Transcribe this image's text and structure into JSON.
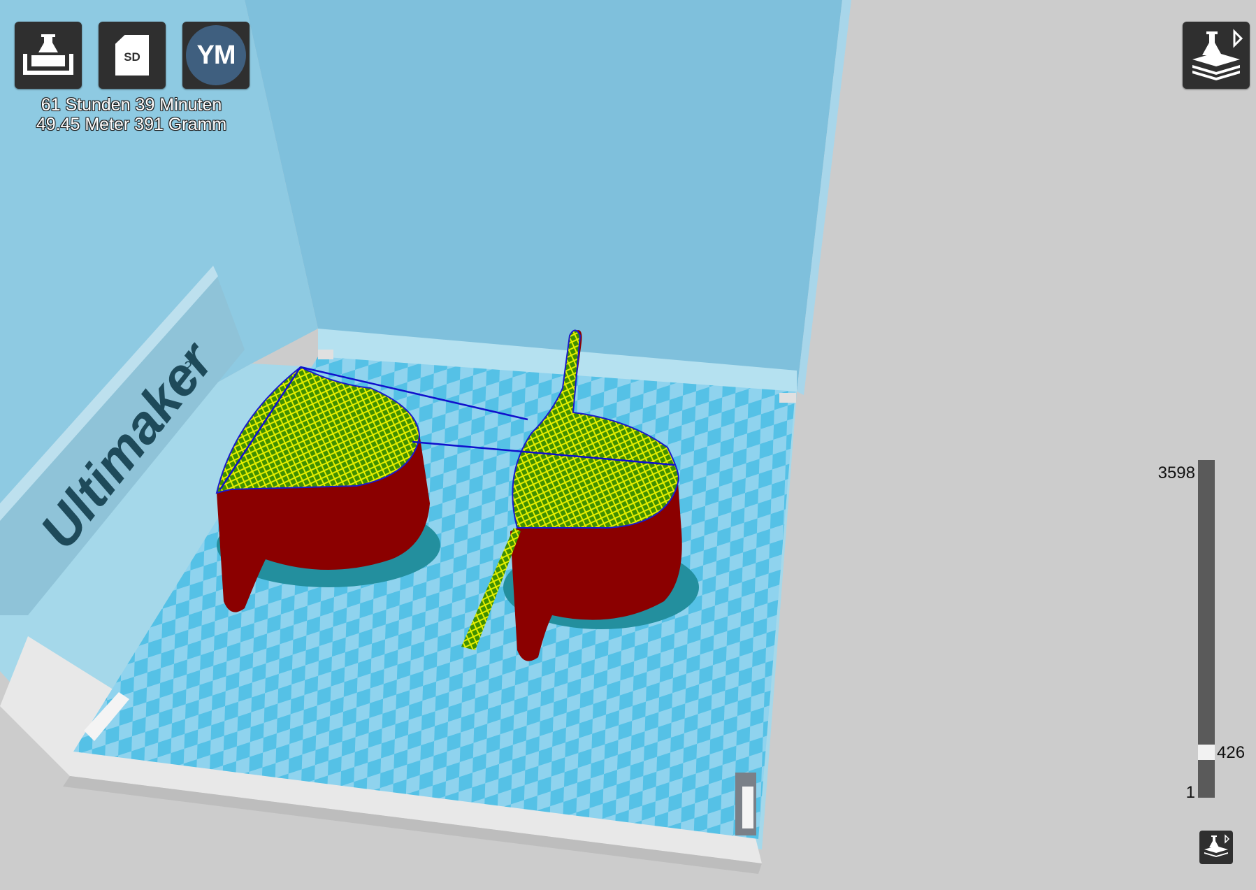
{
  "toolbar": {
    "load_icon": "folder-upload-icon",
    "sd_label": "SD",
    "sd_icon": "sd-card-icon",
    "ym_label": "YM",
    "ym_icon": "youmagine-icon",
    "view_mode_icon": "layer-view-icon"
  },
  "print_info": {
    "time": "61 Stunden 39 Minuten",
    "material": "49.45 Meter 391 Gramm"
  },
  "layer_slider": {
    "max_label": "3598",
    "current_label": "426",
    "min_label": "1",
    "max": 3598,
    "current": 426,
    "min": 1
  },
  "scene": {
    "brand_text": "Ultimaker",
    "brand_superscript": "2",
    "colors": {
      "build_volume": "#80c1dc",
      "plate_light": "#9ddcf0",
      "plate_dark": "#5fc6e8",
      "object_wall": "#8b0000",
      "object_infill": "#c8e000",
      "travel_line": "#1010cc",
      "background": "#cccccc"
    }
  }
}
